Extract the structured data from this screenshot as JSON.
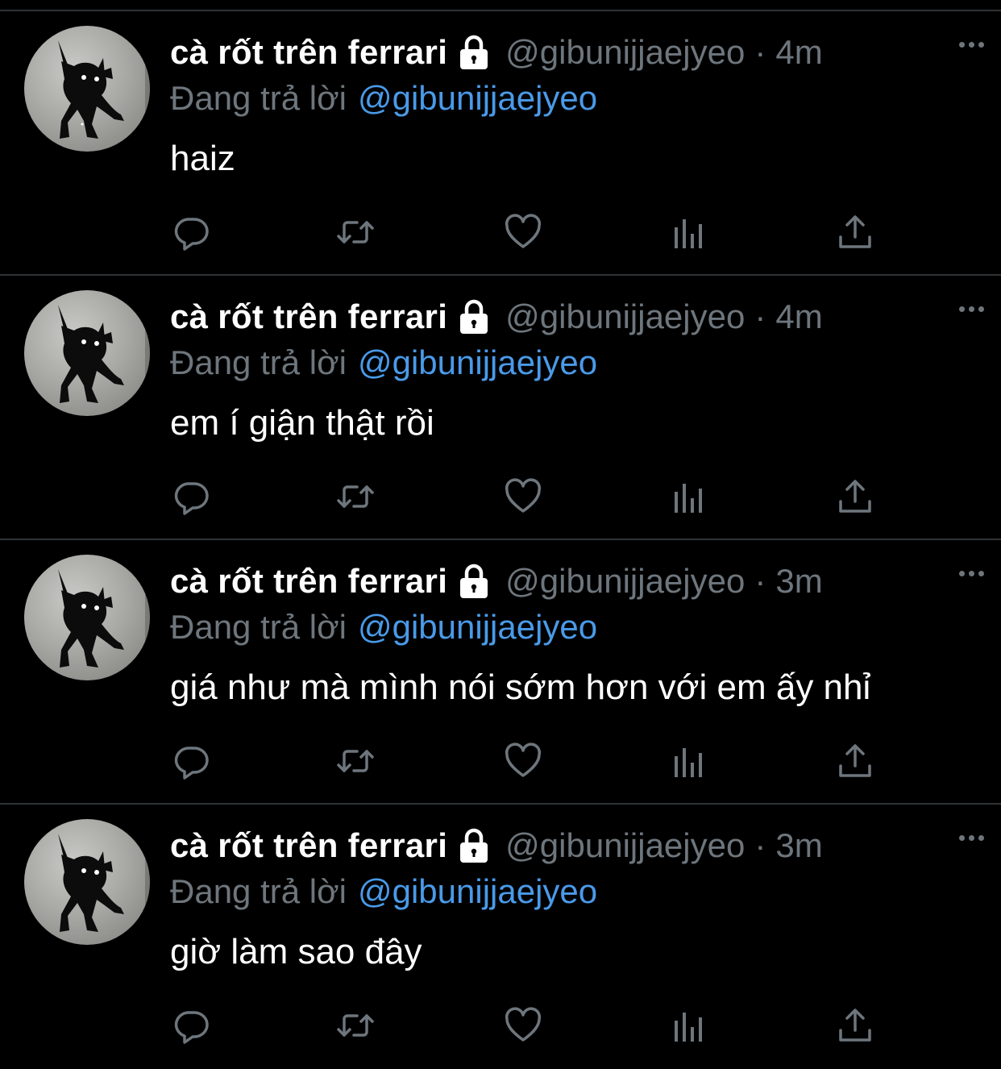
{
  "colors": {
    "background": "#000000",
    "divider": "#2f3336",
    "secondary_text": "#6e767d",
    "mention": "#4a9ae8",
    "primary_text": "#ffffff"
  },
  "icons": {
    "lock": "lock-icon",
    "more": "more-icon",
    "reply": "reply-icon",
    "retweet": "retweet-icon",
    "like": "heart-icon",
    "analytics": "analytics-icon",
    "share": "share-icon"
  },
  "tweets": [
    {
      "display_name": "cà rốt trên ferrari",
      "handle": "@gibunijjaejyeo",
      "separator": "·",
      "time": "4m",
      "reply_label": "Đang trả lời",
      "reply_to": "@gibunijjaejyeo",
      "text": "haiz"
    },
    {
      "display_name": "cà rốt trên ferrari",
      "handle": "@gibunijjaejyeo",
      "separator": "·",
      "time": "4m",
      "reply_label": "Đang trả lời",
      "reply_to": "@gibunijjaejyeo",
      "text": "em í giận thật rồi"
    },
    {
      "display_name": "cà rốt trên ferrari",
      "handle": "@gibunijjaejyeo",
      "separator": "·",
      "time": "3m",
      "reply_label": "Đang trả lời",
      "reply_to": "@gibunijjaejyeo",
      "text": "giá như mà mình nói sớm hơn với em ấy nhỉ"
    },
    {
      "display_name": "cà rốt trên ferrari",
      "handle": "@gibunijjaejyeo",
      "separator": "·",
      "time": "3m",
      "reply_label": "Đang trả lời",
      "reply_to": "@gibunijjaejyeo",
      "text": "giờ làm sao đây"
    }
  ]
}
